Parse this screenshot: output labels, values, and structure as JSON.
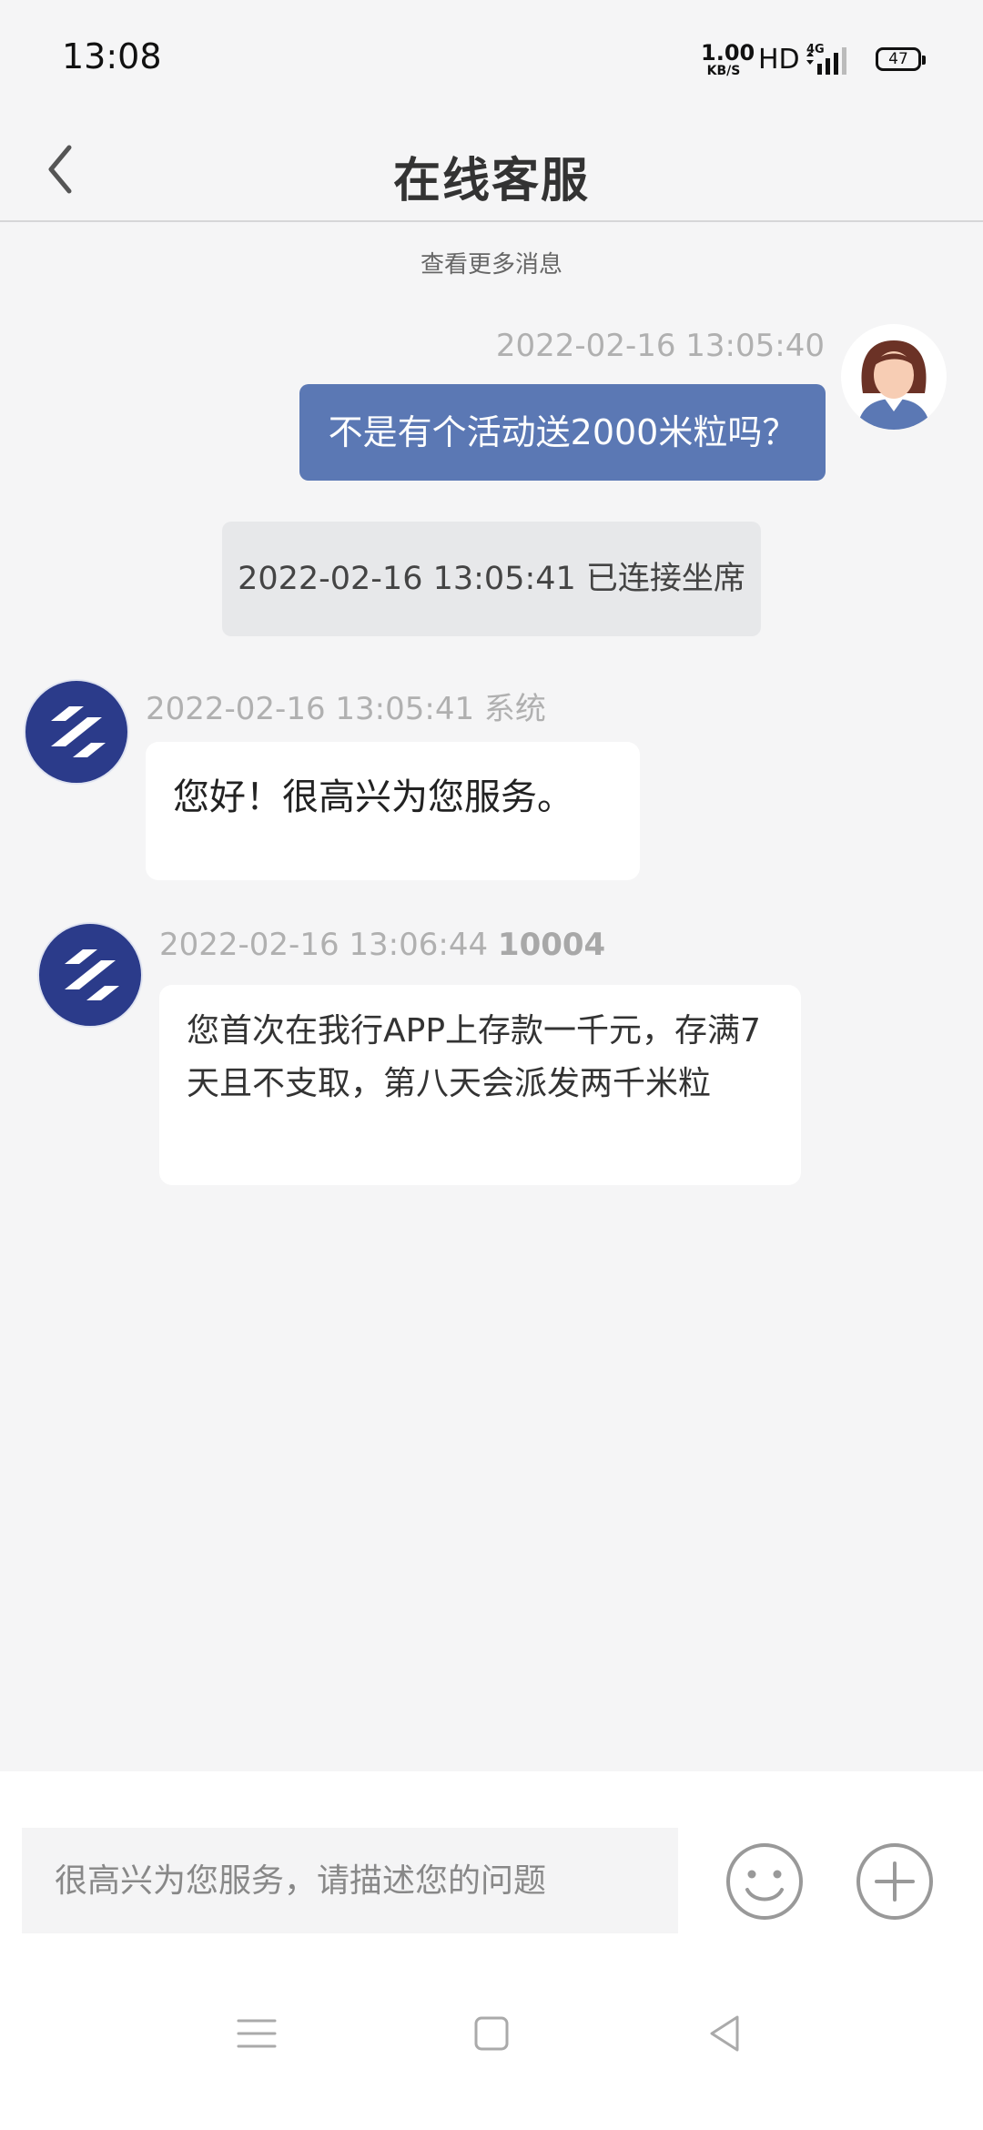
{
  "status_bar": {
    "time": "13:08",
    "net_speed_value": "1.00",
    "net_speed_unit": "KB/S",
    "hd_label": "HD",
    "network": "4G",
    "battery": "47"
  },
  "header": {
    "title": "在线客服",
    "back_icon": "chevron-left-icon"
  },
  "chat": {
    "load_more": "查看更多消息",
    "messages": [
      {
        "side": "user",
        "timestamp": "2022-02-16 13:05:40",
        "text": "不是有个活动送2000米粒吗？"
      },
      {
        "side": "system-note",
        "text": "2022-02-16 13:05:41 已连接坐席"
      },
      {
        "side": "agent",
        "timestamp": "2022-02-16 13:05:41",
        "sender": "系统",
        "text": "您好！很高兴为您服务。"
      },
      {
        "side": "agent",
        "timestamp": "2022-02-16 13:06:44",
        "sender": "10004",
        "text": "您首次在我行APP上存款一千元，存满7天且不支取，第八天会派发两千米粒"
      }
    ]
  },
  "input": {
    "placeholder": "很高兴为您服务，请描述您的问题",
    "emoji_icon": "smiley-icon",
    "plus_icon": "plus-circle-icon"
  },
  "colors": {
    "user_bubble": "#5b78b4",
    "agent_logo": "#2b3b8a",
    "background": "#f5f5f6"
  }
}
